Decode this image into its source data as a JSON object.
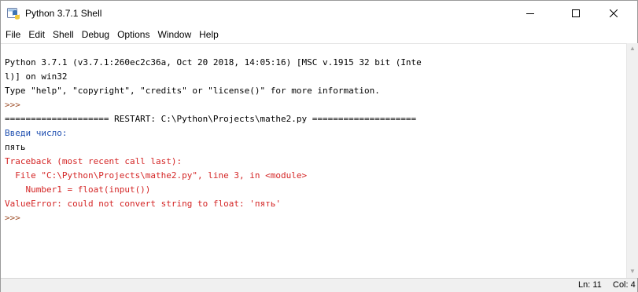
{
  "window": {
    "title": "Python 3.7.1 Shell"
  },
  "menu": [
    "File",
    "Edit",
    "Shell",
    "Debug",
    "Options",
    "Window",
    "Help"
  ],
  "shell": {
    "lines": [
      {
        "text": "Python 3.7.1 (v3.7.1:260ec2c36a, Oct 20 2018, 14:05:16) [MSC v.1915 32 bit (Inte",
        "kind": "out"
      },
      {
        "text": "l)] on win32",
        "kind": "out"
      },
      {
        "text": "Type \"help\", \"copyright\", \"credits\" or \"license()\" for more information.",
        "kind": "out"
      },
      {
        "text": ">>> ",
        "kind": "prompt"
      },
      {
        "text": "==================== RESTART: C:\\Python\\Projects\\mathe2.py ====================",
        "kind": "out"
      },
      {
        "text": "Введи число:",
        "kind": "stdout"
      },
      {
        "text": "пять",
        "kind": "input"
      },
      {
        "text": "Traceback (most recent call last):",
        "kind": "err"
      },
      {
        "text": "  File \"C:\\Python\\Projects\\mathe2.py\", line 3, in <module>",
        "kind": "err"
      },
      {
        "text": "    Number1 = float(input())",
        "kind": "err"
      },
      {
        "text": "ValueError: could not convert string to float: 'пять'",
        "kind": "err"
      },
      {
        "text": ">>> ",
        "kind": "prompt"
      }
    ]
  },
  "status": {
    "line": "Ln: 11",
    "col": "Col: 4"
  },
  "colors": {
    "prompt": "#a0522d",
    "stdout": "#1f4fb0",
    "error": "#d42525",
    "text": "#000000"
  },
  "icons": {
    "app": "python-idle-icon",
    "minimize": "minimize-icon",
    "maximize": "maximize-icon",
    "close": "close-icon",
    "scroll_up": "scroll-up-arrow-icon",
    "scroll_down": "scroll-down-arrow-icon"
  }
}
